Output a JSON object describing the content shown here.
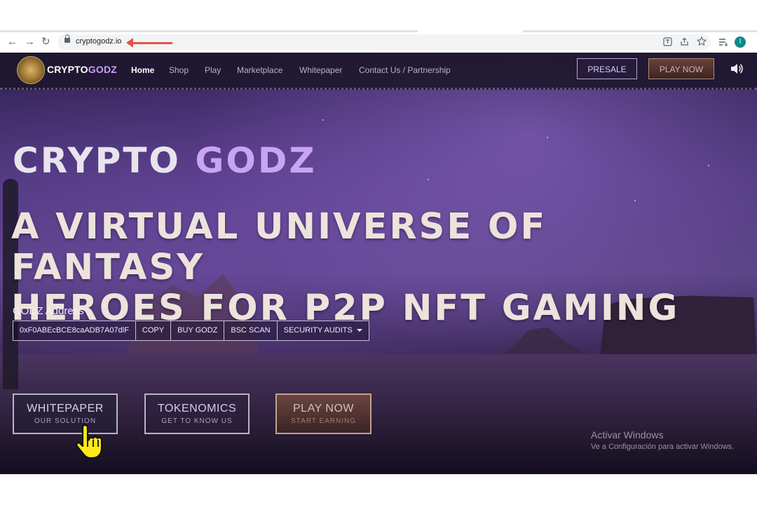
{
  "browser": {
    "url": "cryptogodz.io",
    "back_icon": "←",
    "forward_icon": "→",
    "reload_icon": "↻",
    "profile_initial": "I"
  },
  "site": {
    "brand_prefix": "CRYPTO",
    "brand_accent": "GODZ",
    "nav": [
      "Home",
      "Shop",
      "Play",
      "Marketplace",
      "Whitepaper",
      "Contact Us / Partnership"
    ],
    "presale_label": "PRESALE",
    "play_now_label": "PLAY NOW",
    "speaker_icon": "speaker-icon"
  },
  "hero": {
    "title_prefix": "CRYPTO",
    "title_accent": "GODZ",
    "tagline_line1": "A VIRTUAL UNIVERSE OF FANTASY",
    "tagline_line2": "HEROES FOR P2P NFT GAMING",
    "address_label": "GODZ Address",
    "address": "0xF0ABEcBCE8caADB7A07dlF",
    "copy_label": "COPY",
    "buy_label": "BUY GODZ",
    "bsc_label": "BSC SCAN",
    "audits_label": "SECURITY AUDITS"
  },
  "cta": [
    {
      "main": "WHITEPAPER",
      "sub": "OUR SOLUTION"
    },
    {
      "main": "TOKENOMICS",
      "sub": "GET TO KNOW US"
    },
    {
      "main": "PLAY NOW",
      "sub": "START EARNING"
    }
  ],
  "watermark": {
    "title": "Activar Windows",
    "subtitle": "Ve a Configuración para activar Windows."
  },
  "colors": {
    "accent_purple": "#c9a4f3",
    "annotation_arrow": "#e2534b",
    "cursor_yellow": "#ffe81a"
  }
}
